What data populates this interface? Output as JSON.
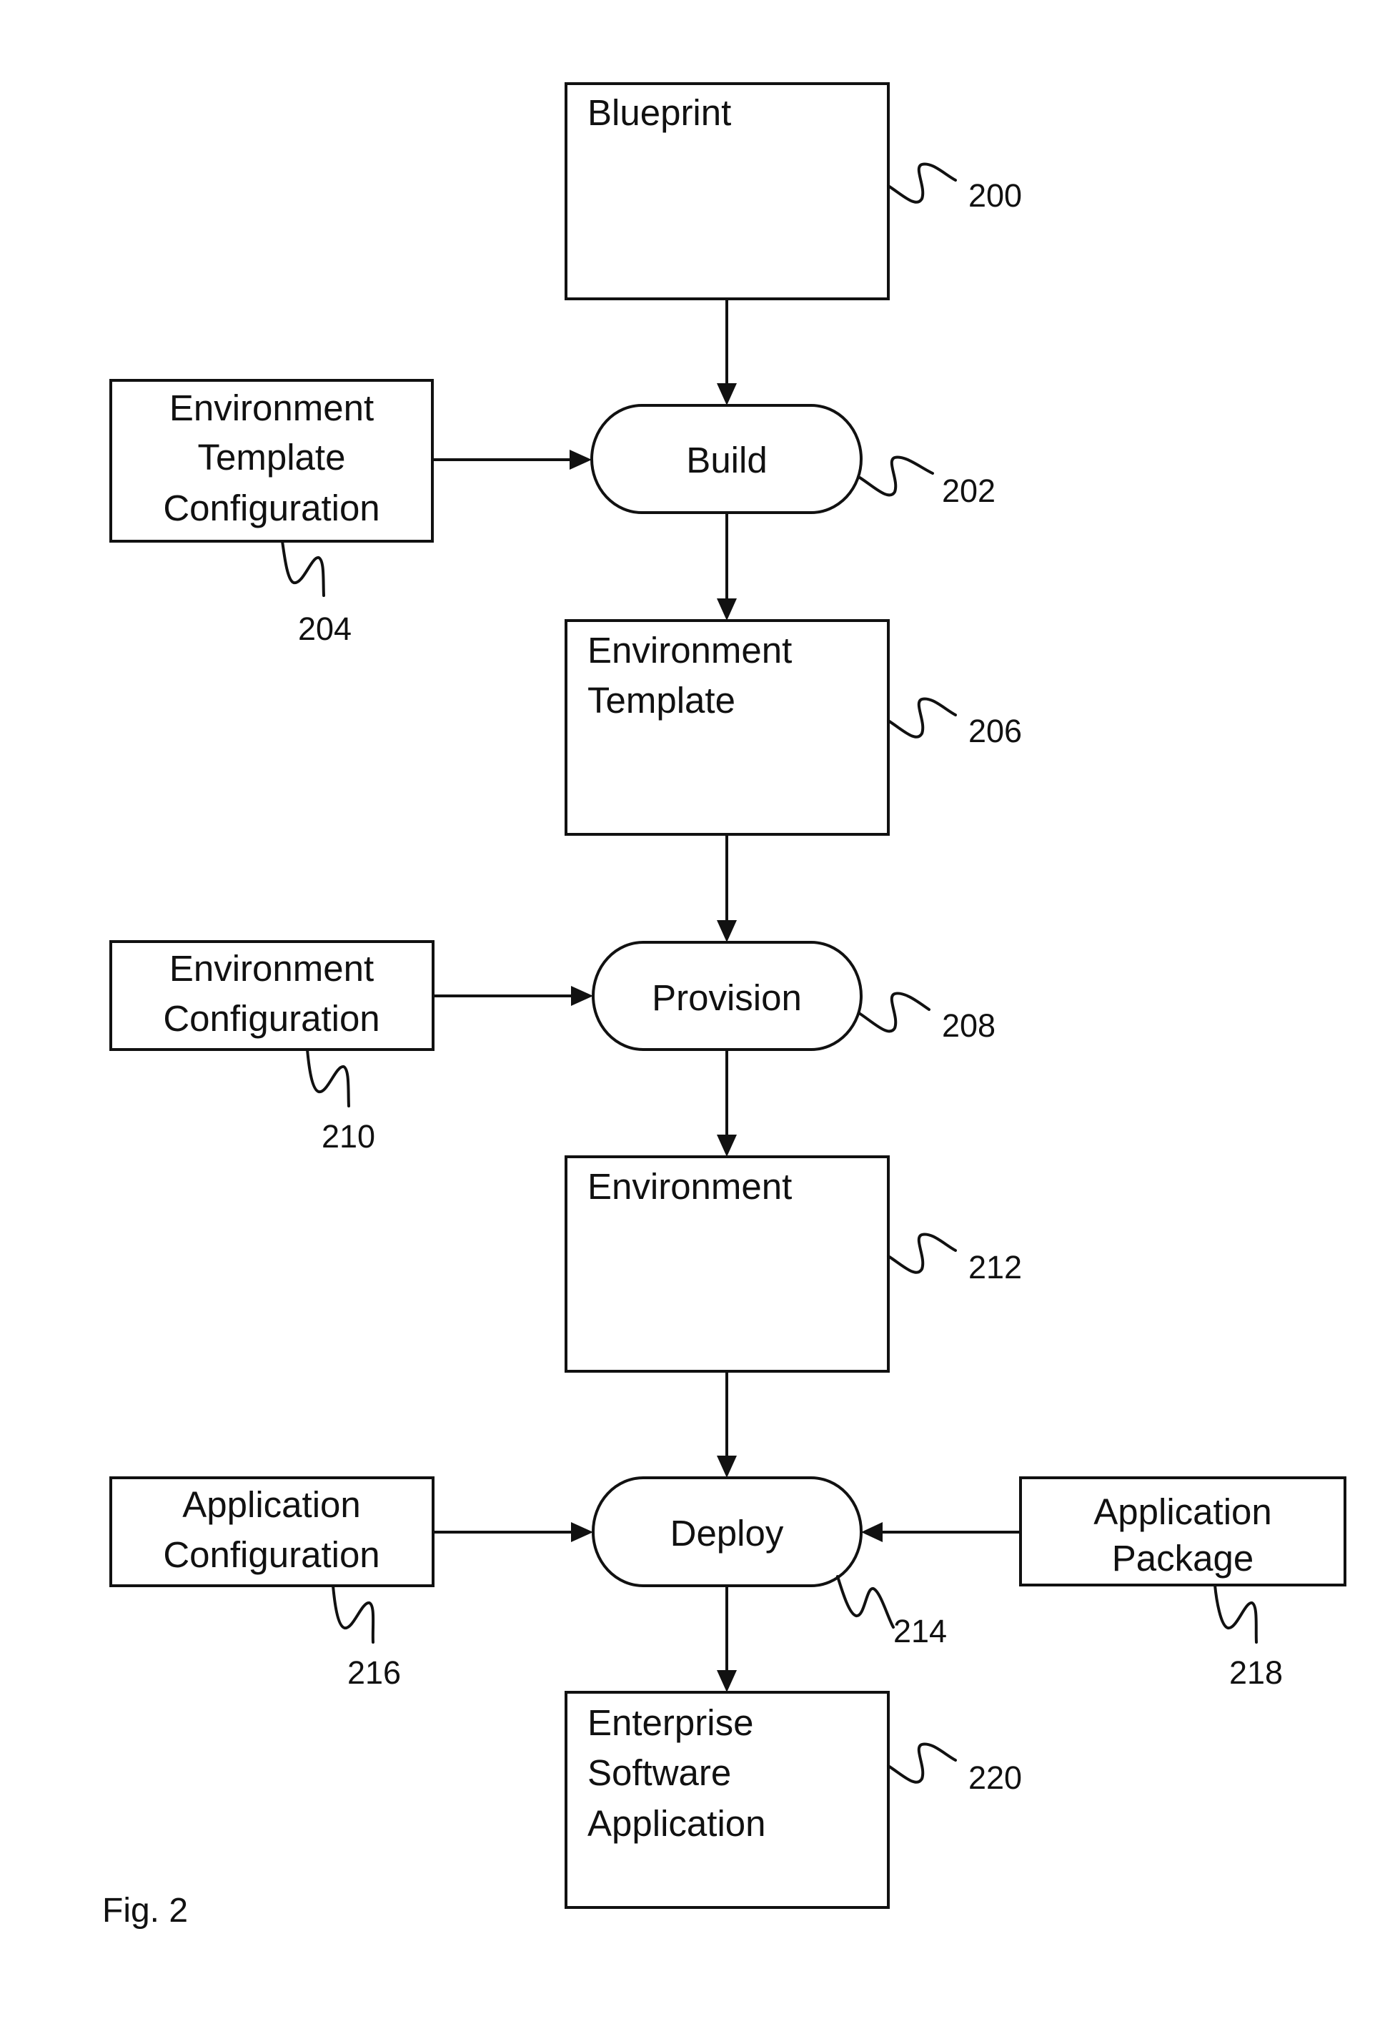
{
  "figure": {
    "caption": "Fig. 2",
    "colors": {
      "line": "#111111",
      "background": "#ffffff"
    },
    "nodes": [
      {
        "id": "blueprint",
        "shape": "box",
        "lines": [
          "Blueprint"
        ],
        "ref": "200"
      },
      {
        "id": "build",
        "shape": "process-pill",
        "lines": [
          "Build"
        ],
        "ref": "202"
      },
      {
        "id": "env-template-config",
        "shape": "box",
        "lines": [
          "Environment",
          "Template",
          "Configuration"
        ],
        "ref": "204"
      },
      {
        "id": "env-template",
        "shape": "box",
        "lines": [
          "Environment",
          "Template"
        ],
        "ref": "206"
      },
      {
        "id": "provision",
        "shape": "process-pill",
        "lines": [
          "Provision"
        ],
        "ref": "208"
      },
      {
        "id": "env-config",
        "shape": "box",
        "lines": [
          "Environment",
          "Configuration"
        ],
        "ref": "210"
      },
      {
        "id": "environment",
        "shape": "box",
        "lines": [
          "Environment"
        ],
        "ref": "212"
      },
      {
        "id": "deploy",
        "shape": "process-pill",
        "lines": [
          "Deploy"
        ],
        "ref": "214"
      },
      {
        "id": "app-config",
        "shape": "box",
        "lines": [
          "Application",
          "Configuration"
        ],
        "ref": "216"
      },
      {
        "id": "app-package",
        "shape": "box",
        "lines": [
          "Application",
          "Package"
        ],
        "ref": "218"
      },
      {
        "id": "enterprise-app",
        "shape": "box",
        "lines": [
          "Enterprise",
          "Software",
          "Application"
        ],
        "ref": "220"
      }
    ],
    "edges": [
      {
        "from": "blueprint",
        "to": "build"
      },
      {
        "from": "env-template-config",
        "to": "build"
      },
      {
        "from": "build",
        "to": "env-template"
      },
      {
        "from": "env-template",
        "to": "provision"
      },
      {
        "from": "env-config",
        "to": "provision"
      },
      {
        "from": "provision",
        "to": "environment"
      },
      {
        "from": "environment",
        "to": "deploy"
      },
      {
        "from": "app-config",
        "to": "deploy"
      },
      {
        "from": "app-package",
        "to": "deploy"
      },
      {
        "from": "deploy",
        "to": "enterprise-app"
      }
    ]
  }
}
